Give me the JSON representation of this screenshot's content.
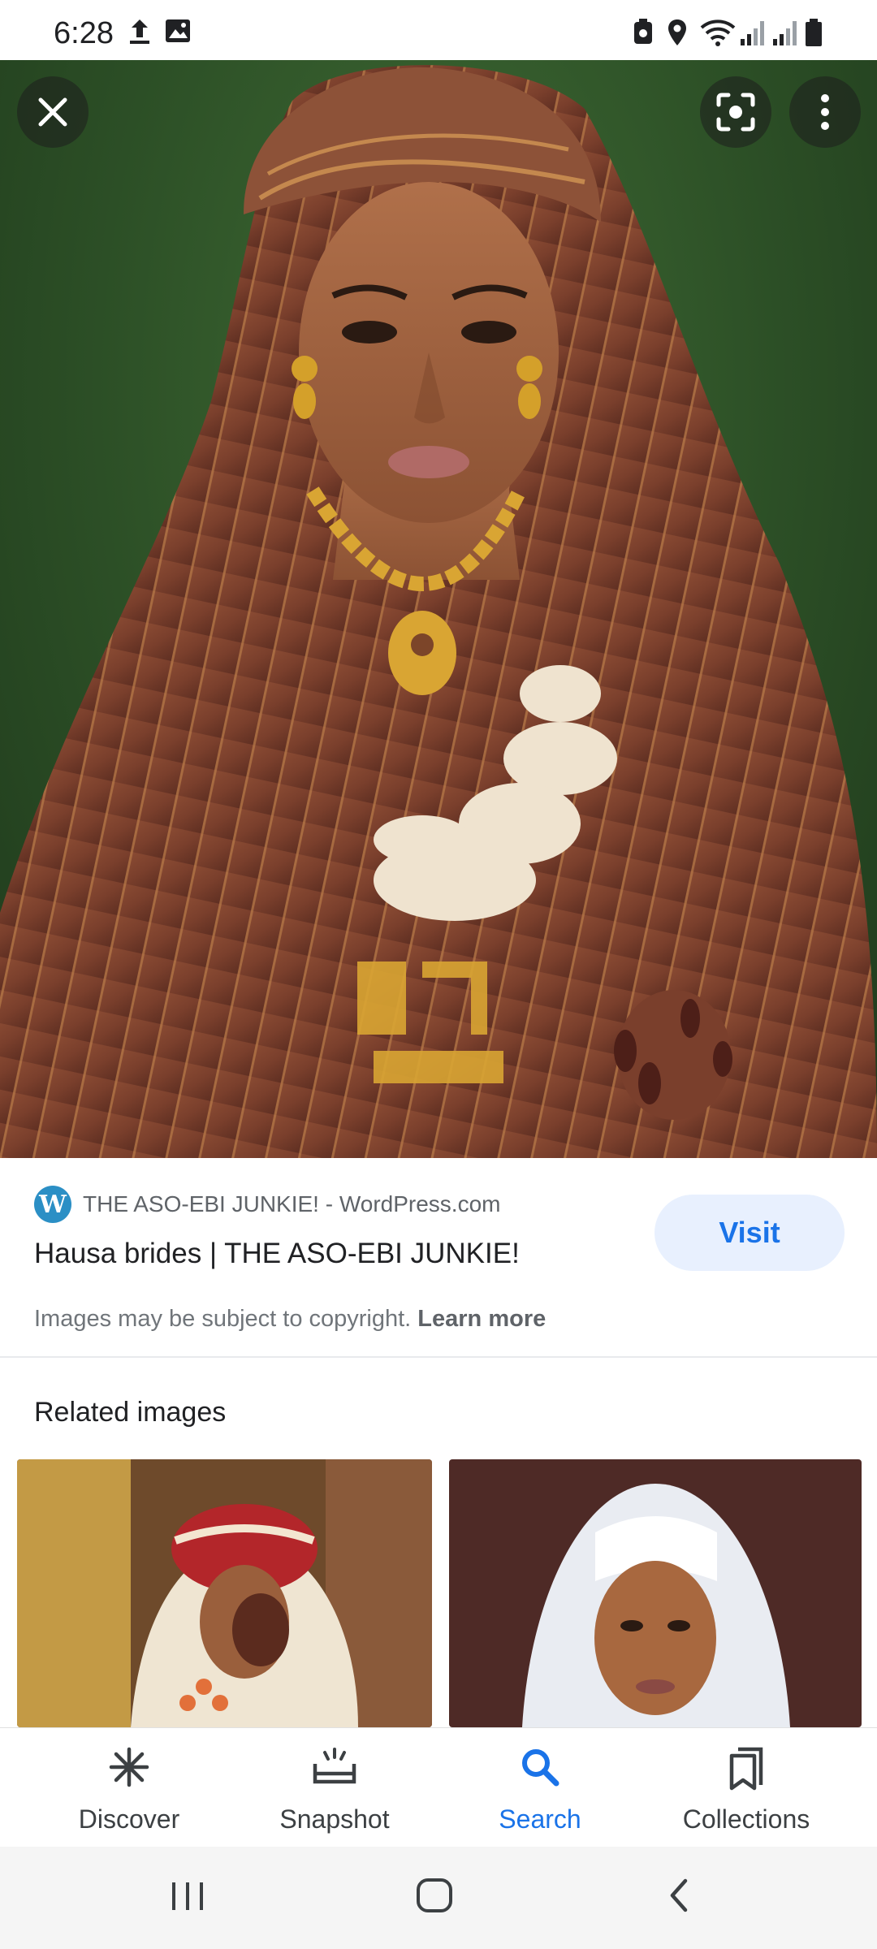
{
  "status_bar": {
    "time": "6:28"
  },
  "viewer": {
    "close_label": "Close",
    "lens_label": "Search inside image",
    "menu_label": "More options"
  },
  "result": {
    "source_name": "THE ASO-EBI JUNKIE! - WordPress.com",
    "title": "Hausa brides | THE ASO-EBI JUNKIE!",
    "visit_label": "Visit",
    "copyright_text": "Images may be subject to copyright.",
    "learn_more": "Learn more"
  },
  "related": {
    "heading": "Related images"
  },
  "bottom_nav": {
    "items": [
      {
        "label": "Discover"
      },
      {
        "label": "Snapshot"
      },
      {
        "label": "Search"
      },
      {
        "label": "Collections"
      }
    ]
  },
  "colors": {
    "accent": "#1a73e8",
    "visit_bg": "#e8f0fe",
    "wordpress": "#2b8fc5"
  }
}
